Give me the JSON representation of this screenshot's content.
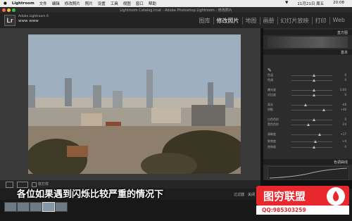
{
  "menubar": {
    "app": "Lightroom",
    "items": [
      "文件",
      "编辑",
      "修改照片",
      "照片",
      "设置",
      "工具",
      "视图",
      "窗口",
      "帮助"
    ],
    "date": "11月21日 周五",
    "time": "20:08"
  },
  "window": {
    "title": "Lightroom Catalog.lrcat - Adobe Photoshop Lightroom - 修改照片"
  },
  "identity": {
    "logo": "Lr",
    "product": "Adobe Lightroom 6",
    "user": "www www"
  },
  "modules": [
    "图库",
    "修改照片",
    "地图",
    "画册",
    "幻灯片放映",
    "打印",
    "Web"
  ],
  "active_module": "修改照片",
  "panel": {
    "histogram_header": "直方图",
    "basic_header": "基本",
    "tone_curve_header": "色调曲线",
    "sliders": [
      {
        "label": "色温",
        "value": "0"
      },
      {
        "label": "色调",
        "value": "0"
      },
      {
        "label": "曝光度",
        "value": "0.00"
      },
      {
        "label": "对比度",
        "value": "0"
      },
      {
        "label": "高光",
        "value": "-48"
      },
      {
        "label": "阴影",
        "value": "+46"
      },
      {
        "label": "白色色阶",
        "value": "0"
      },
      {
        "label": "黑色色阶",
        "value": "-24"
      },
      {
        "label": "清晰度",
        "value": "+17"
      },
      {
        "label": "鲜艳度",
        "value": "+4"
      },
      {
        "label": "饱和度",
        "value": "0"
      }
    ]
  },
  "toolbar": {
    "soft_proof": "软打样"
  },
  "filmstrip": {
    "label": "过滤器",
    "filter": "关闭"
  },
  "subtitle": "各位如果遇到闪烁比较严重的情况下",
  "watermark": {
    "title": "图穷联盟",
    "qq": "QQ:985303259",
    "brand_color": "#e8282d"
  }
}
